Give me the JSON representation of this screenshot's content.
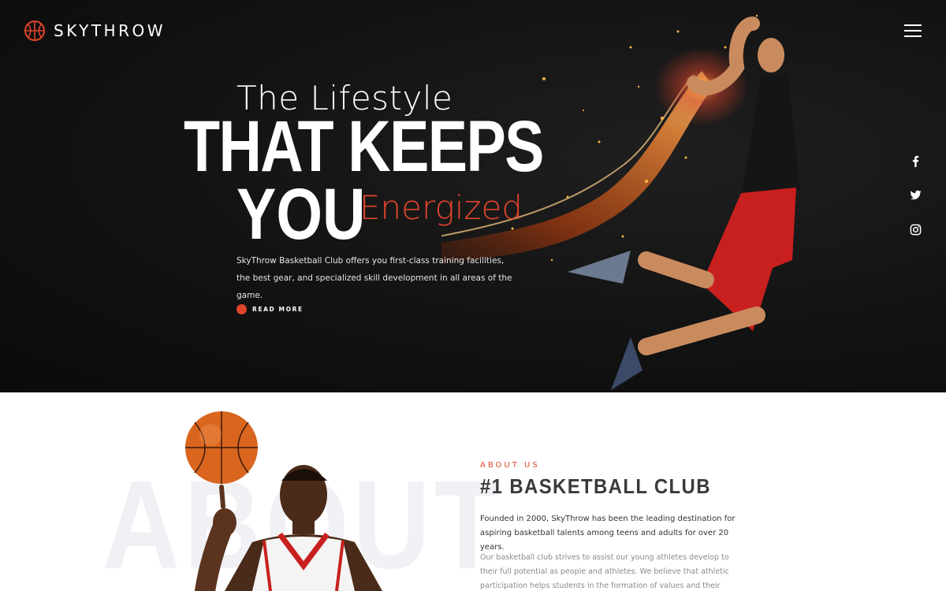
{
  "brand": {
    "name": "SKYTHROW",
    "accent": "#e0452b"
  },
  "nav": {
    "menu_icon": "hamburger-icon"
  },
  "social": [
    {
      "name": "facebook",
      "icon": "facebook-icon"
    },
    {
      "name": "twitter",
      "icon": "twitter-icon"
    },
    {
      "name": "instagram",
      "icon": "instagram-icon"
    }
  ],
  "hero": {
    "pre_title": "The Lifestyle",
    "line1": "THAT KEEPS",
    "line2": "YOU",
    "accent_word": "Energized",
    "description": "SkyThrow Basketball Club offers you first-class training facilities, the best gear, and specialized skill development in all areas of the game.",
    "cta_label": "READ MORE"
  },
  "about": {
    "bg_word": "ABOUT",
    "kicker": "ABOUT US",
    "title": "#1 BASKETBALL CLUB",
    "lead": "Founded in 2000, SkyThrow has been the leading destination for aspiring basketball talents among teens and adults for over 20 years.",
    "body": "Our basketball club strives to assist our young athletes develop to their full potential as people and athletes. We believe that athletic participation helps students in the formation of values and their development as mature"
  }
}
